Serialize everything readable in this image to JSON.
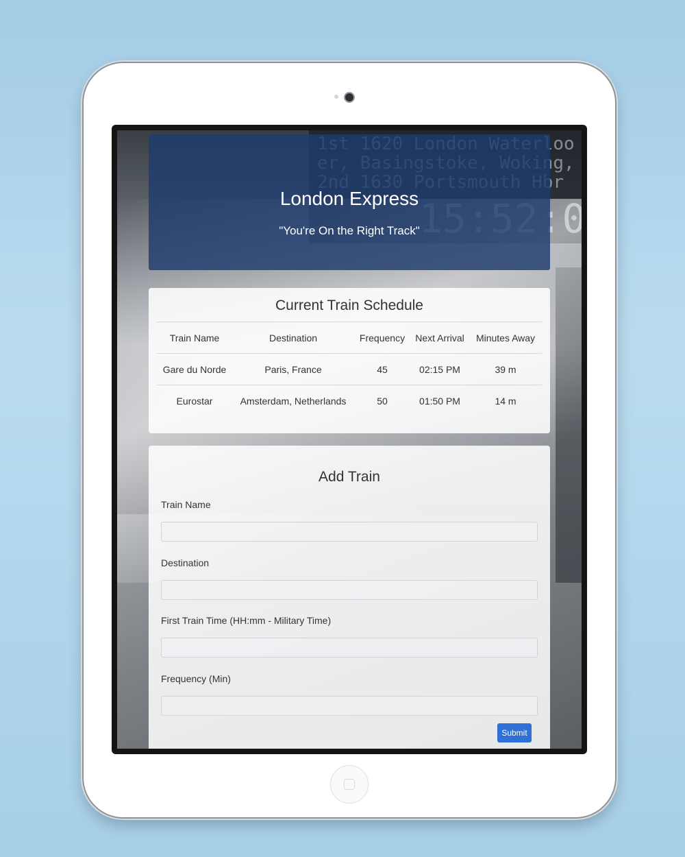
{
  "header": {
    "title": "London Express",
    "tagline": "\"You're On the Right Track\""
  },
  "schedule": {
    "title": "Current Train Schedule",
    "columns": [
      "Train Name",
      "Destination",
      "Frequency",
      "Next Arrival",
      "Minutes Away"
    ],
    "rows": [
      [
        "Gare du Norde",
        "Paris, France",
        "45",
        "02:15 PM",
        "39 m"
      ],
      [
        "Eurostar",
        "Amsterdam, Netherlands",
        "50",
        "01:50 PM",
        "14 m"
      ]
    ]
  },
  "form": {
    "title": "Add Train",
    "fields": [
      {
        "label": "Train Name",
        "value": ""
      },
      {
        "label": "Destination",
        "value": ""
      },
      {
        "label": "First Train Time (HH:mm - Military Time)",
        "value": ""
      },
      {
        "label": "Frequency (Min)",
        "value": ""
      }
    ],
    "submit_label": "Submit"
  },
  "colors": {
    "jumbotron": "#1e3c6e",
    "submit_button": "#2f6fd6",
    "page_background": "#a4cde6"
  }
}
